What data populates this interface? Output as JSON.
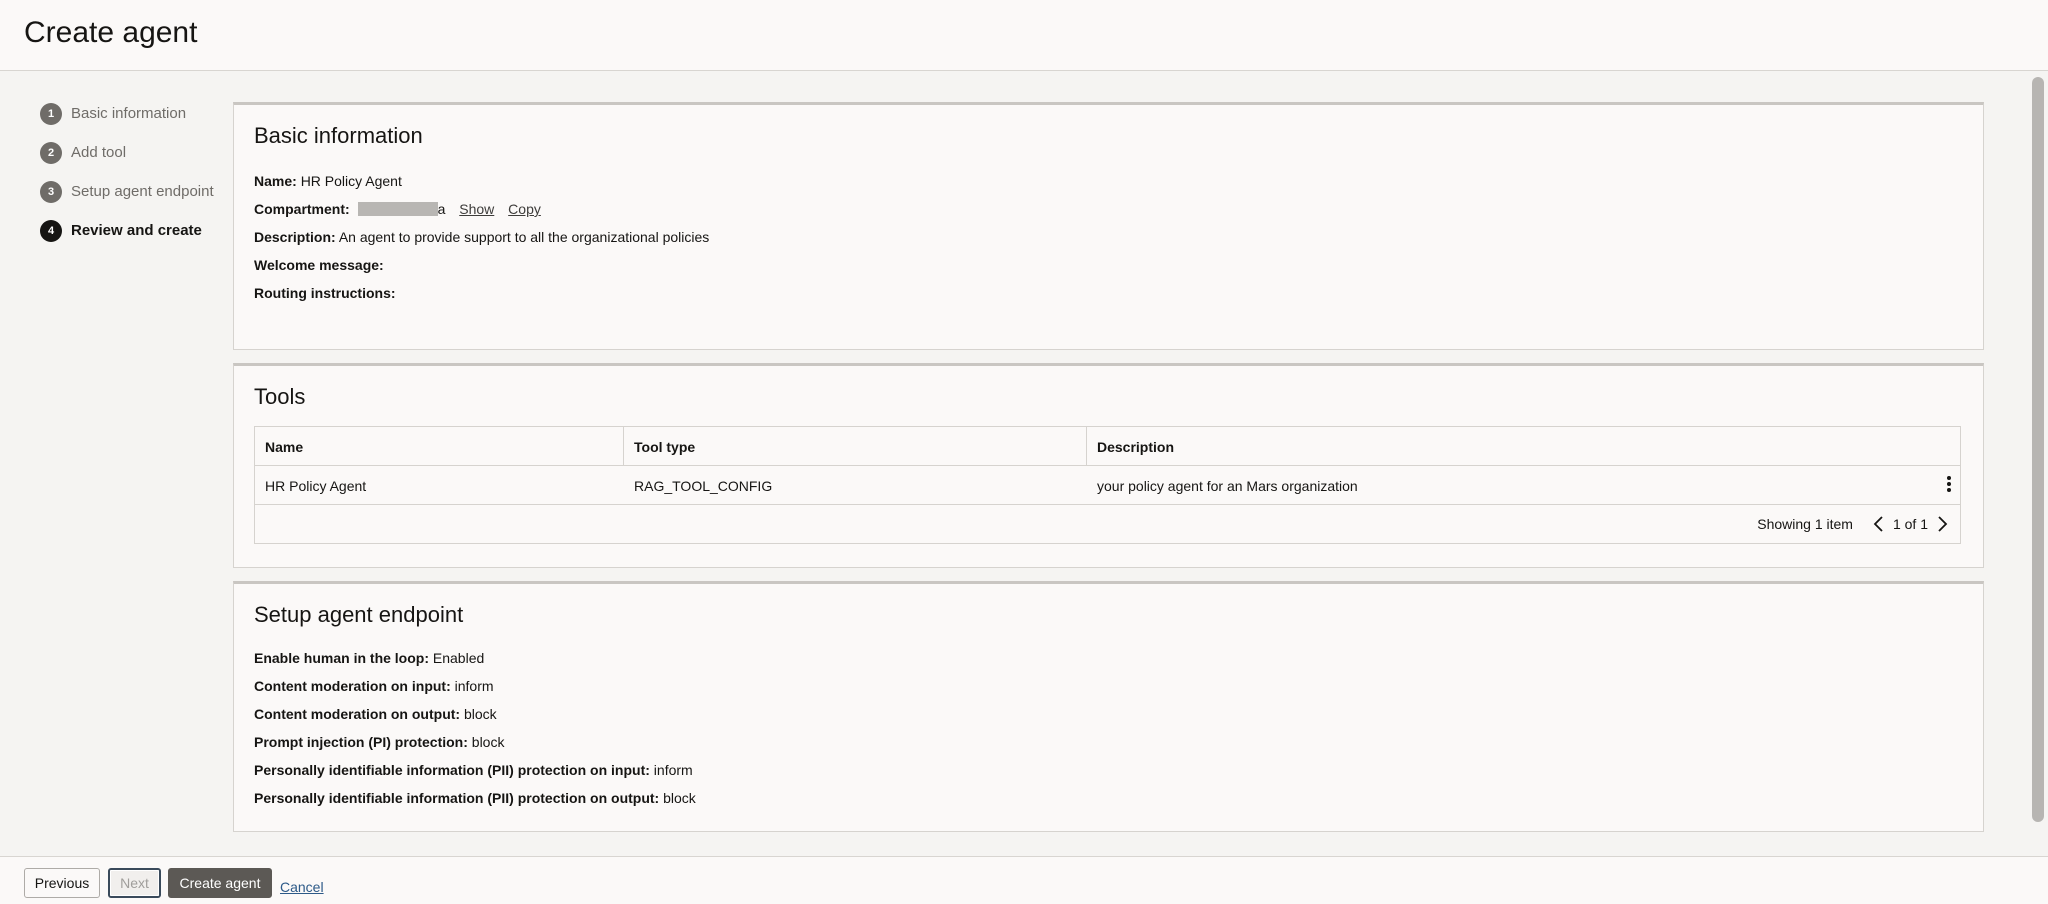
{
  "page": {
    "title": "Create agent"
  },
  "steps": [
    {
      "num": "1",
      "label": "Basic information"
    },
    {
      "num": "2",
      "label": "Add tool"
    },
    {
      "num": "3",
      "label": "Setup agent endpoint"
    },
    {
      "num": "4",
      "label": "Review and create"
    }
  ],
  "basic": {
    "title": "Basic information",
    "name_label": "Name:",
    "name_value": "HR Policy Agent",
    "compartment_label": "Compartment:",
    "compartment_suffix": "a",
    "show_link": "Show",
    "copy_link": "Copy",
    "description_label": "Description:",
    "description_value": "An agent to provide support to all the organizational policies",
    "welcome_label": "Welcome message:",
    "routing_label": "Routing instructions:"
  },
  "tools": {
    "title": "Tools",
    "columns": [
      "Name",
      "Tool type",
      "Description"
    ],
    "rows": [
      {
        "name": "HR Policy Agent",
        "type": "RAG_TOOL_CONFIG",
        "description": "your policy agent for an Mars organization"
      }
    ],
    "showing": "Showing 1 item",
    "page_text": "1 of 1"
  },
  "endpoint": {
    "title": "Setup agent endpoint",
    "fields": [
      {
        "label": "Enable human in the loop:",
        "value": "Enabled"
      },
      {
        "label": "Content moderation on input:",
        "value": "inform"
      },
      {
        "label": "Content moderation on output:",
        "value": "block"
      },
      {
        "label": "Prompt injection (PI) protection:",
        "value": "block"
      },
      {
        "label": "Personally identifiable information (PII) protection on input:",
        "value": "inform"
      },
      {
        "label": "Personally identifiable information (PII) protection on output:",
        "value": "block"
      }
    ]
  },
  "footer": {
    "previous": "Previous",
    "next": "Next",
    "create": "Create agent",
    "cancel": "Cancel"
  }
}
